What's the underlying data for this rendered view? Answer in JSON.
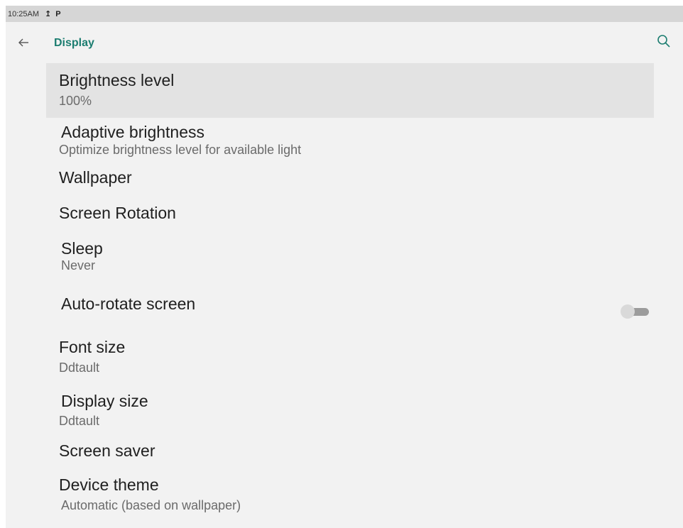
{
  "status_bar": {
    "time": "10:25AM",
    "icons": [
      "upload-icon",
      "parking-icon"
    ],
    "upload_glyph": "↥",
    "parking_glyph": "P"
  },
  "app_bar": {
    "title": "Display",
    "back_icon": "arrow-back-icon",
    "search_icon": "search-icon",
    "accent_color": "#1c7d70"
  },
  "settings": {
    "brightness": {
      "title": "Brightness level",
      "subtitle": "100%"
    },
    "adaptive": {
      "title": "Adaptive brightness",
      "subtitle": "Optimize brightness level for available light"
    },
    "wallpaper": {
      "title": "Wallpaper"
    },
    "rotation": {
      "title": "Screen Rotation"
    },
    "sleep": {
      "title": "Sleep",
      "subtitle": "Never"
    },
    "auto_rotate": {
      "title": "Auto-rotate screen",
      "toggle_on": false
    },
    "font_size": {
      "title": "Font size",
      "subtitle": "Ddtault"
    },
    "display_size": {
      "title": "Display size",
      "subtitle": "Ddtault"
    },
    "screen_saver": {
      "title": "Screen saver"
    },
    "device_theme": {
      "title": "Device theme",
      "subtitle": "Automatic (based on wallpaper)"
    }
  }
}
